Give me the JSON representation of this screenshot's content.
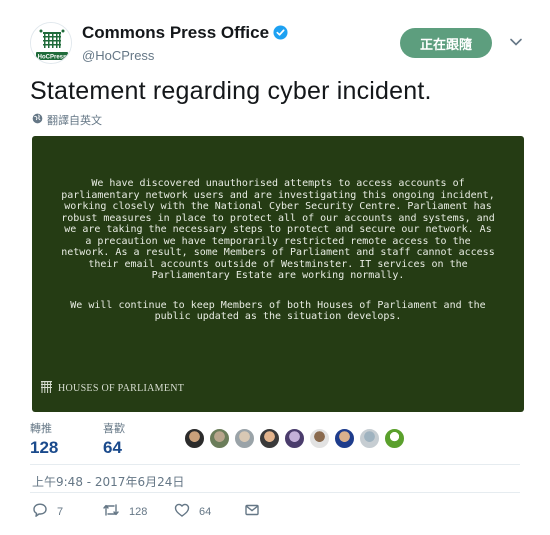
{
  "tweet": {
    "display_name": "Commons Press Office",
    "handle": "@HoCPress",
    "follow_label": "正在跟隨",
    "text": "Statement regarding cyber incident.",
    "translate_label": "翻譯自英文",
    "timestamp": "上午9:48 - 2017年6月24日"
  },
  "avatar": {
    "logo_text": "HoCPress"
  },
  "media": {
    "paragraph1": "We have discovered unauthorised attempts to access accounts of parliamentary network users and are investigating this ongoing incident, working closely with the National Cyber Security Centre. Parliament has robust measures in place to protect all of our accounts and systems, and we are taking the necessary steps to protect and secure our network. As a precaution we have temporarily restricted remote access to the network. As a result, some Members of Parliament and staff cannot access their email accounts outside of Westminster. IT services on the Parliamentary Estate are working normally.",
    "paragraph2": "We will continue to keep Members of both Houses of Parliament and the public updated as the situation develops.",
    "footer_label": "HOUSES OF PARLIAMENT"
  },
  "stats": {
    "retweets_label": "轉推",
    "retweets_value": "128",
    "likes_label": "喜歡",
    "likes_value": "64"
  },
  "actions": {
    "reply_count": "7",
    "retweet_count": "128",
    "like_count": "64"
  },
  "colors": {
    "media_background": "#253c14",
    "follow_button": "#5d9e7e",
    "verified_badge": "#1da1f2",
    "secondary_text": "#657786"
  },
  "icons": [
    "verified-badge-icon",
    "chevron-down-icon",
    "globe-icon",
    "portcullis-icon",
    "reply-icon",
    "retweet-icon",
    "like-icon",
    "dm-icon"
  ]
}
